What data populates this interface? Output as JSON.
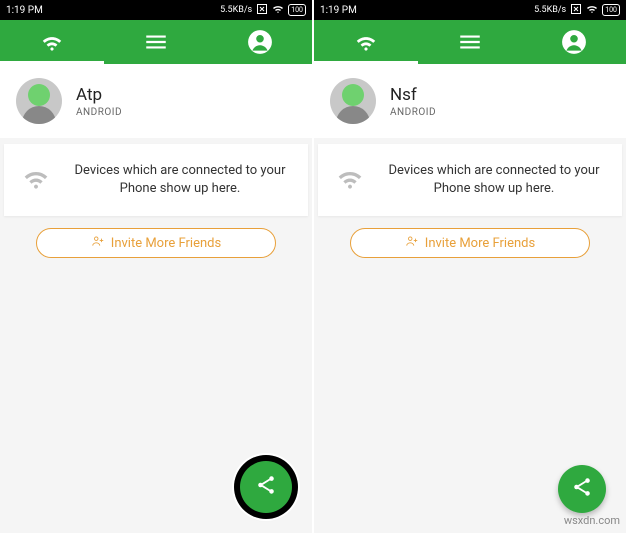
{
  "watermark": "wsxdn.com",
  "phones": [
    {
      "status": {
        "time": "1:19 PM",
        "speed": "5.5KB/s",
        "battery": "100"
      },
      "profile": {
        "name": "Atp",
        "platform": "ANDROID"
      },
      "devices_message": "Devices which are connected to your Phone show up here.",
      "invite_label": "Invite More Friends",
      "fab_highlight": true
    },
    {
      "status": {
        "time": "1:19 PM",
        "speed": "5.5KB/s",
        "battery": "100"
      },
      "profile": {
        "name": "Nsf",
        "platform": "ANDROID"
      },
      "devices_message": "Devices which are connected to your Phone show up here.",
      "invite_label": "Invite More Friends",
      "fab_highlight": false
    }
  ]
}
